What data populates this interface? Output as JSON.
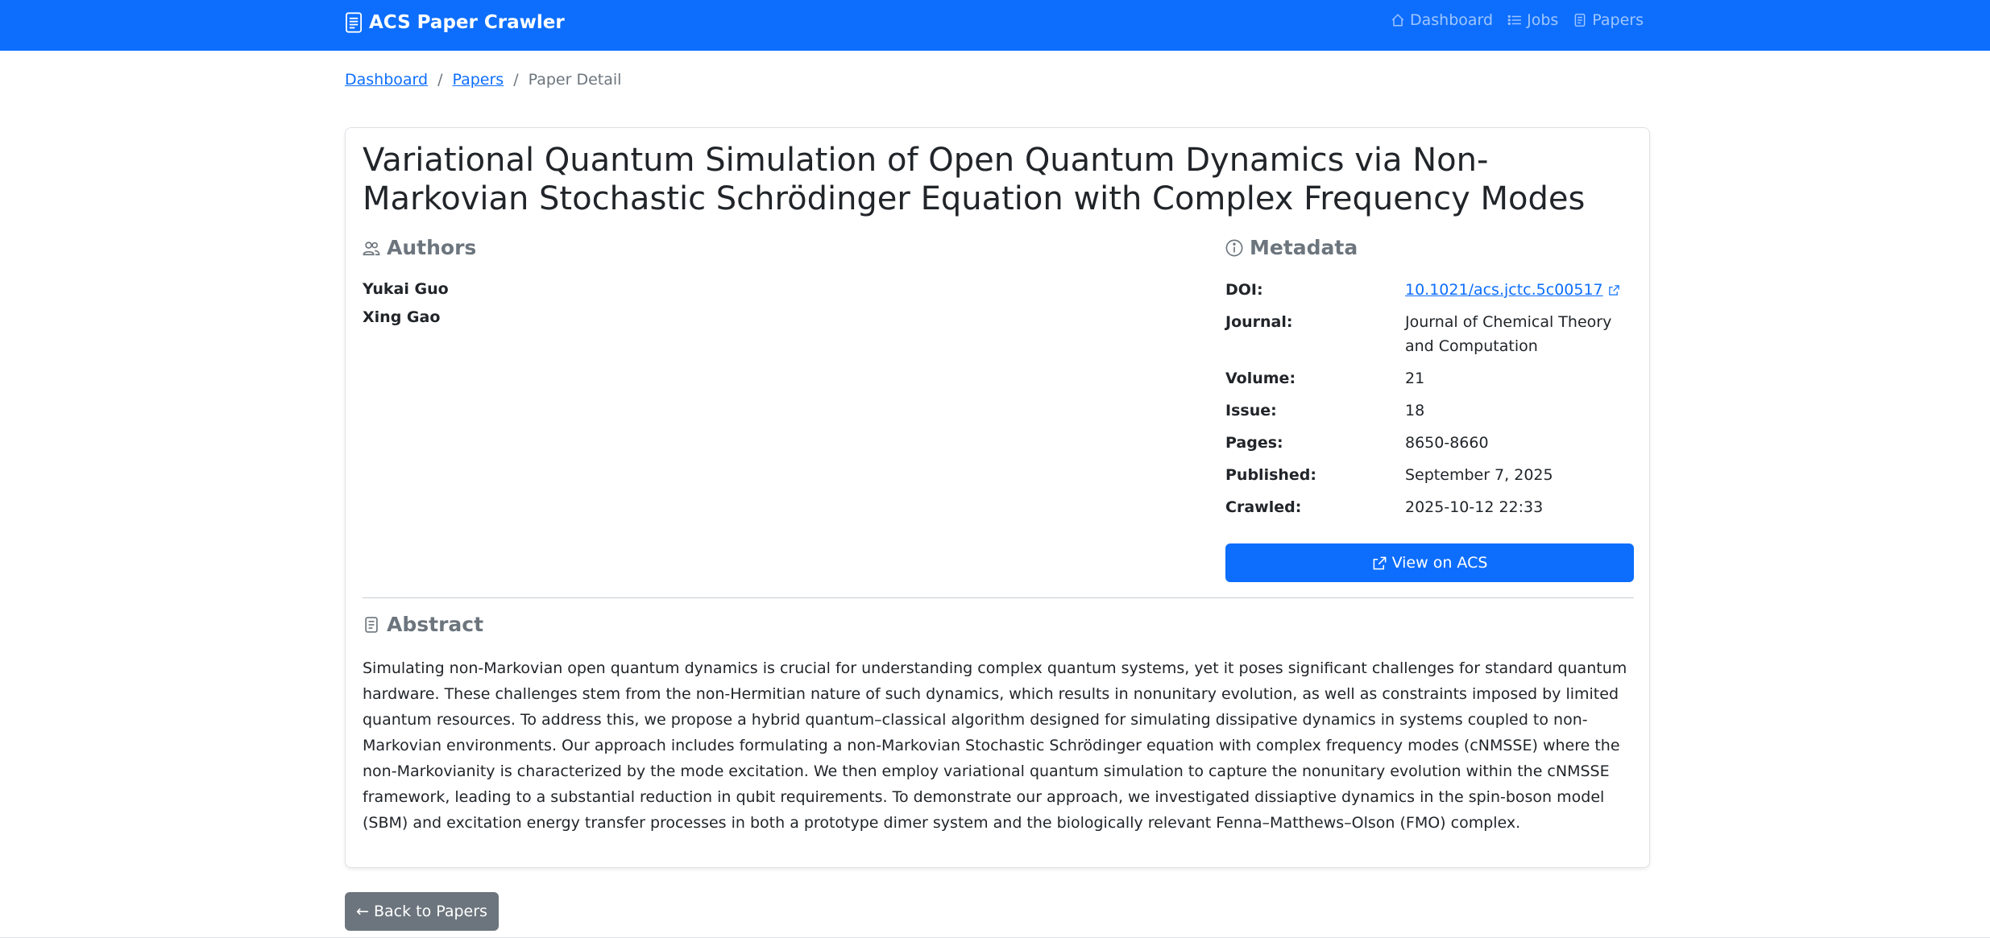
{
  "navbar": {
    "brand": "ACS Paper Crawler",
    "links": [
      {
        "label": "Dashboard",
        "icon": "house-icon"
      },
      {
        "label": "Jobs",
        "icon": "list-icon"
      },
      {
        "label": "Papers",
        "icon": "document-icon"
      }
    ]
  },
  "breadcrumb": {
    "items": [
      "Dashboard",
      "Papers"
    ],
    "current": "Paper Detail",
    "separator": "/"
  },
  "paper": {
    "title": "Variational Quantum Simulation of Open Quantum Dynamics via Non-Markovian Stochastic Schrödinger Equation with Complex Frequency Modes",
    "authors_heading": "Authors",
    "authors": [
      "Yukai Guo",
      "Xing Gao"
    ],
    "metadata_heading": "Metadata",
    "metadata": [
      {
        "key": "DOI:",
        "value": "10.1021/acs.jctc.5c00517"
      },
      {
        "key": "Journal:",
        "value": "Journal of Chemical Theory and Computation"
      },
      {
        "key": "Volume:",
        "value": "21"
      },
      {
        "key": "Issue:",
        "value": "18"
      },
      {
        "key": "Pages:",
        "value": "8650-8660"
      },
      {
        "key": "Published:",
        "value": "September 7, 2025"
      },
      {
        "key": "Crawled:",
        "value": "2025-10-12 22:33"
      }
    ],
    "view_button": "View on ACS",
    "abstract_heading": "Abstract",
    "abstract": "Simulating non-Markovian open quantum dynamics is crucial for understanding complex quantum systems, yet it poses significant challenges for standard quantum hardware. These challenges stem from the non-Hermitian nature of such dynamics, which results in nonunitary evolution, as well as constraints imposed by limited quantum resources. To address this, we propose a hybrid quantum–classical algorithm designed for simulating dissipative dynamics in systems coupled to non-Markovian environments. Our approach includes formulating a non-Markovian Stochastic Schrödinger equation with complex frequency modes (cNMSSE) where the non-Markovianity is characterized by the mode excitation. We then employ variational quantum simulation to capture the nonunitary evolution within the cNMSSE framework, leading to a substantial reduction in qubit requirements. To demonstrate our approach, we investigated dissiaptive dynamics in the spin-boson model (SBM) and excitation energy transfer processes in both a prototype dimer system and the biologically relevant Fenna–Matthews–Olson (FMO) complex."
  },
  "back_button": "Back to Papers",
  "colors": {
    "primary": "#0d6efd",
    "secondary": "#6c757d"
  }
}
